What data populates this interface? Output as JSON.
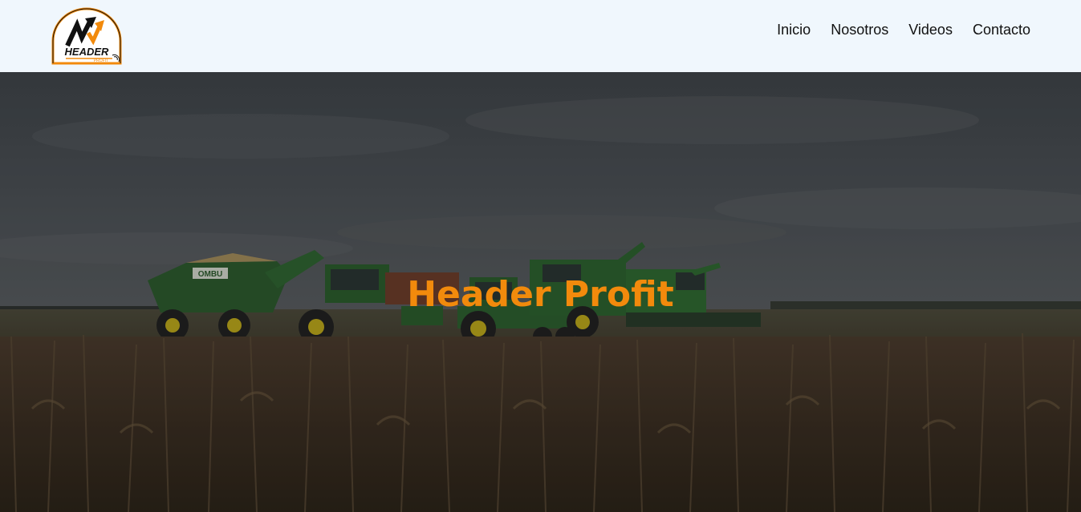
{
  "brand": {
    "logo_text": "HEADER",
    "logo_subtext": "PROFIT",
    "accent_color": "#f28a0c"
  },
  "nav": {
    "items": [
      {
        "label": "Inicio"
      },
      {
        "label": "Nosotros"
      },
      {
        "label": "Videos"
      },
      {
        "label": "Contacto"
      }
    ]
  },
  "hero": {
    "title": "Header Profit",
    "background_image": "harvest-field-with-combines-and-tractors",
    "trailer_text": "OMBU"
  }
}
